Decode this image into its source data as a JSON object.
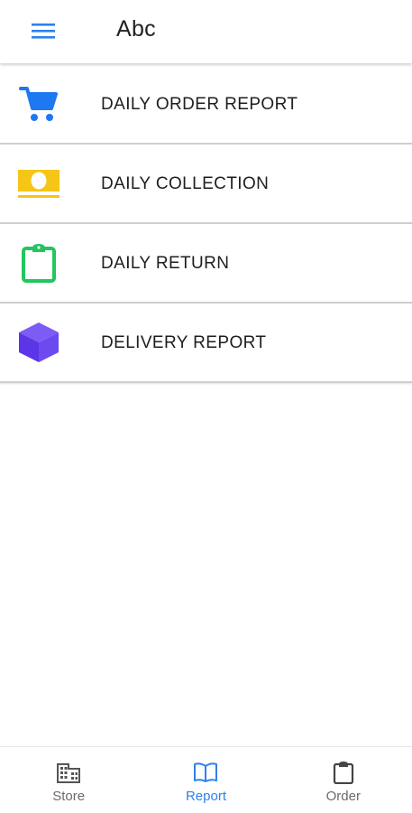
{
  "appbar": {
    "title": "Abc",
    "menu_icon": "hamburger-menu-icon"
  },
  "reports": [
    {
      "label": "DAILY ORDER REPORT",
      "icon": "shopping-cart-icon",
      "color": "#1e78f0"
    },
    {
      "label": "DAILY COLLECTION",
      "icon": "cash-icon",
      "color": "#f5c518"
    },
    {
      "label": "DAILY RETURN",
      "icon": "clipboard-icon",
      "color": "#22c55e"
    },
    {
      "label": "DELIVERY REPORT",
      "icon": "cube-icon",
      "color": "#6d4af0"
    }
  ],
  "bottom_nav": {
    "active": "Report",
    "active_color": "#2f80ed",
    "items": [
      {
        "label": "Store",
        "icon": "building-icon"
      },
      {
        "label": "Report",
        "icon": "book-icon"
      },
      {
        "label": "Order",
        "icon": "clipboard-icon"
      }
    ]
  }
}
